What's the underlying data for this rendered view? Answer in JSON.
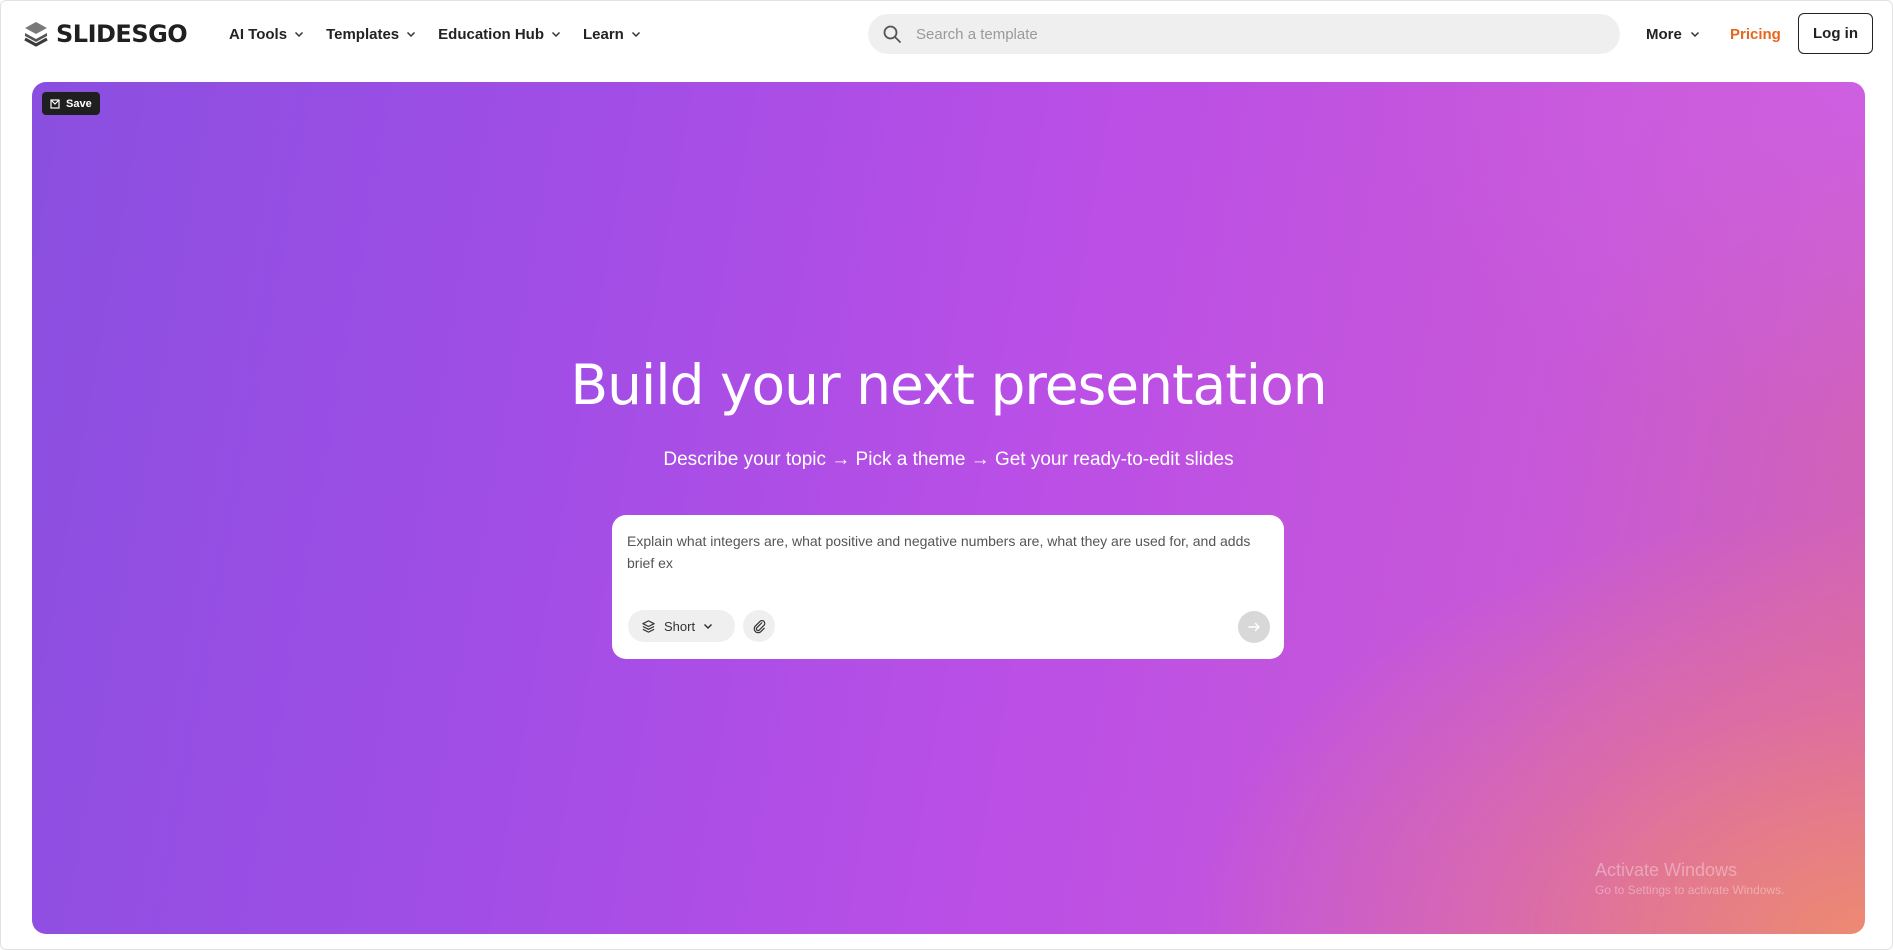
{
  "header": {
    "logo_text": "SLIDESGO",
    "nav": [
      {
        "label": "AI Tools"
      },
      {
        "label": "Templates"
      },
      {
        "label": "Education Hub"
      },
      {
        "label": "Learn"
      }
    ],
    "search_placeholder": "Search a template",
    "more_label": "More",
    "pricing_label": "Pricing",
    "login_label": "Log in"
  },
  "hero": {
    "save_label": "Save",
    "title": "Build your next presentation",
    "subtitle": "Describe your topic → Pick a theme → Get your ready-to-edit slides",
    "prompt_value": "Explain what integers are, what positive and negative numbers are, what they are used for, and adds brief ex",
    "length_option": "Short"
  },
  "watermark": {
    "title": "Activate Windows",
    "subtitle": "Go to Settings to activate Windows."
  },
  "colors": {
    "pricing": "#e8651c",
    "hero_gradient_start": "#8a4fe0",
    "hero_gradient_end": "#ee8c6e"
  },
  "icons": [
    "slidesgo-logo-icon",
    "chevron-down-icon",
    "search-icon",
    "save-icon",
    "layers-icon",
    "paperclip-icon",
    "arrow-right-icon"
  ]
}
